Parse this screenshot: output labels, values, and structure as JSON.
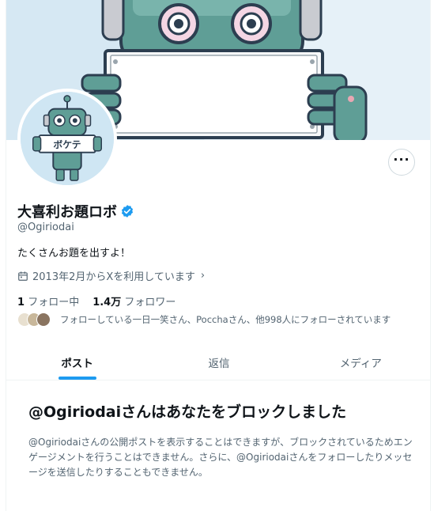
{
  "profile": {
    "display_name": "大喜利お題ロボ",
    "handle": "@Ogiriodai",
    "bio": "たくさんお題を出すよ！",
    "joined": "2013年2月からXを利用しています",
    "avatar_sign_text": "ボケテ",
    "verified": true
  },
  "stats": {
    "following_count": "1",
    "following_label": "フォロー中",
    "followers_count": "1.4万",
    "followers_label": "フォロワー"
  },
  "known_followers": {
    "text": "フォローしている一日一笑さん、Pocchaさん、他998人にフォローされています"
  },
  "tabs": [
    {
      "label": "ポスト",
      "active": true
    },
    {
      "label": "返信",
      "active": false
    },
    {
      "label": "メディア",
      "active": false
    }
  ],
  "blocked": {
    "title": "@Ogiriodaiさんはあなたをブロックしました",
    "message": "@Ogiriodaiさんの公開ポストを表示することはできますが、ブロックされているためエンゲージメントを行うことはできません。さらに、@Ogiriodaiさんをフォローしたりメッセージを送信したりすることもできません。"
  },
  "icons": {
    "more": "more-horizontal-icon",
    "verified": "verified-badge-icon",
    "calendar": "calendar-icon",
    "chevron": "chevron-right-icon"
  },
  "colors": {
    "accent": "#1d9bf0",
    "secondary_text": "#536471",
    "border": "#eff3f4"
  }
}
